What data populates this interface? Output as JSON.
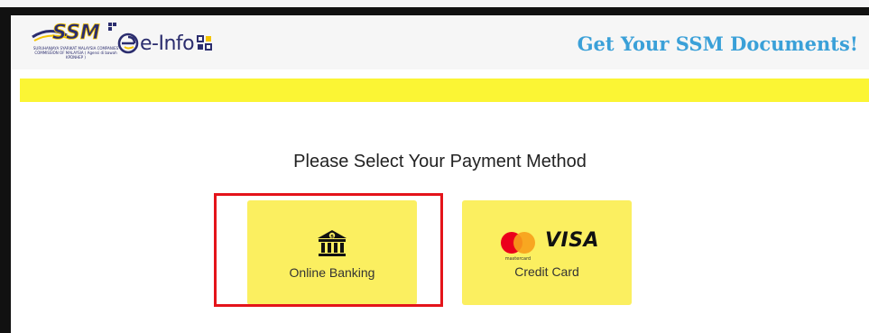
{
  "header": {
    "logo_text": "SSM",
    "logo_subtitle": "SURUHANJAYA SYARIKAT MALAYSIA COMPANIES COMMISSION OF MALAYSIA ( Agensi di bawah KPDNHEP )",
    "product_name": "e-Info",
    "tagline": "Get Your SSM Documents!"
  },
  "main": {
    "prompt": "Please Select Your Payment Method",
    "payment_options": [
      {
        "label": "Online Banking",
        "icon": "bank-icon",
        "highlighted": true
      },
      {
        "label": "Credit Card",
        "icon": "mastercard-visa-icon",
        "highlighted": false
      }
    ],
    "mastercard_label": "mastercard",
    "visa_label": "VISA"
  },
  "colors": {
    "accent_yellow": "#fbf534",
    "card_yellow": "#fbef60",
    "tagline_blue": "#3aa0d8",
    "brand_navy": "#2b2d6e",
    "highlight_red": "#e4141a",
    "mastercard_red": "#eb001b",
    "mastercard_orange": "#f79e1b"
  }
}
